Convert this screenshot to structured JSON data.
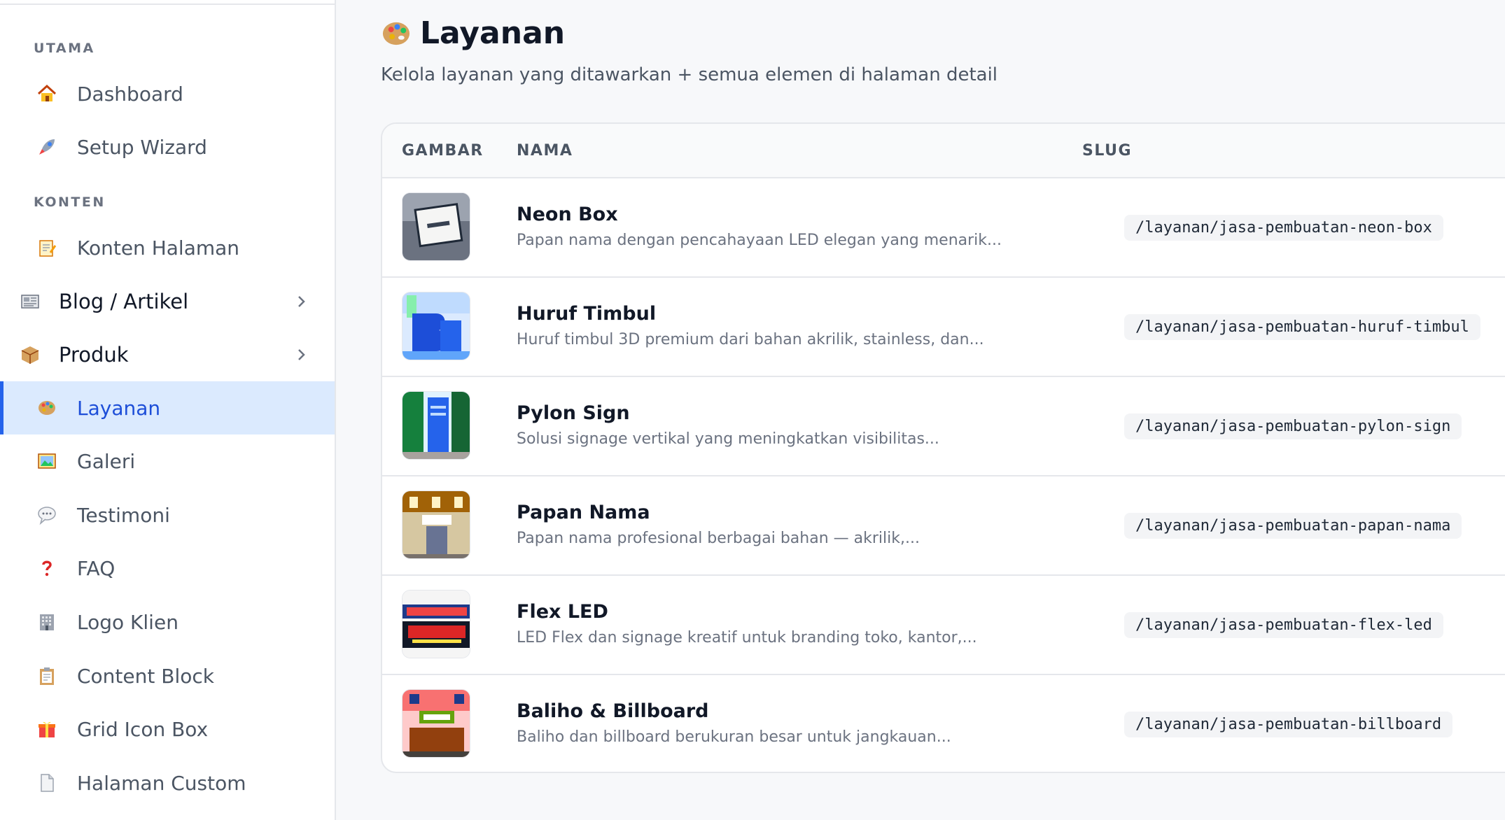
{
  "sidebar": {
    "sections": [
      {
        "label": "UTAMA"
      },
      {
        "label": "KONTEN"
      }
    ],
    "items": [
      {
        "label": "Dashboard",
        "icon": "house-icon"
      },
      {
        "label": "Setup Wizard",
        "icon": "rocket-icon"
      },
      {
        "label": "Konten Halaman",
        "icon": "memo-icon"
      },
      {
        "label": "Blog / Artikel",
        "icon": "newspaper-icon"
      },
      {
        "label": "Produk",
        "icon": "package-icon"
      },
      {
        "label": "Layanan",
        "icon": "palette-icon",
        "active": true
      },
      {
        "label": "Galeri",
        "icon": "framed-picture-icon"
      },
      {
        "label": "Testimoni",
        "icon": "speech-bubble-icon"
      },
      {
        "label": "FAQ",
        "icon": "question-mark-icon"
      },
      {
        "label": "Logo Klien",
        "icon": "office-building-icon"
      },
      {
        "label": "Content Block",
        "icon": "clipboard-icon"
      },
      {
        "label": "Grid Icon Box",
        "icon": "gift-icon"
      },
      {
        "label": "Halaman Custom",
        "icon": "page-icon"
      }
    ]
  },
  "page": {
    "title": "Layanan",
    "subtitle": "Kelola layanan yang ditawarkan + semua elemen di halaman detail"
  },
  "table": {
    "columns": [
      "GAMBAR",
      "NAMA",
      "SLUG"
    ],
    "rows": [
      {
        "name": "Neon Box",
        "desc": "Papan nama dengan pencahayaan LED elegan yang menarik...",
        "slug": "/layanan/jasa-pembuatan-neon-box"
      },
      {
        "name": "Huruf Timbul",
        "desc": "Huruf timbul 3D premium dari bahan akrilik, stainless, dan...",
        "slug": "/layanan/jasa-pembuatan-huruf-timbul"
      },
      {
        "name": "Pylon Sign",
        "desc": "Solusi signage vertikal yang meningkatkan visibilitas...",
        "slug": "/layanan/jasa-pembuatan-pylon-sign"
      },
      {
        "name": "Papan Nama",
        "desc": "Papan nama profesional berbagai bahan — akrilik,...",
        "slug": "/layanan/jasa-pembuatan-papan-nama"
      },
      {
        "name": "Flex LED",
        "desc": "LED Flex dan signage kreatif untuk branding toko, kantor,...",
        "slug": "/layanan/jasa-pembuatan-flex-led"
      },
      {
        "name": "Baliho & Billboard",
        "desc": "Baliho dan billboard berukuran besar untuk jangkauan...",
        "slug": "/layanan/jasa-pembuatan-billboard"
      }
    ]
  },
  "colors": {
    "accent": "#2563eb",
    "active_bg": "#dbeafe"
  }
}
